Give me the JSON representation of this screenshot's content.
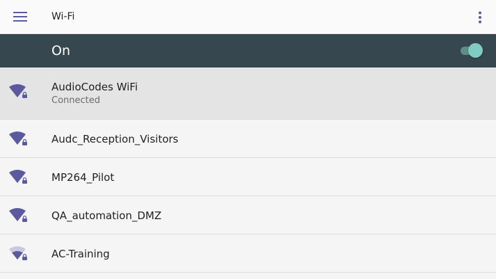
{
  "header": {
    "title": "Wi-Fi",
    "menu_icon": "hamburger-menu-icon",
    "overflow_icon": "more-vert-icon"
  },
  "switch_bar": {
    "label": "On",
    "enabled": true
  },
  "networks": [
    {
      "name": "AudioCodes WiFi",
      "status": "Connected",
      "secured": true,
      "signal": "full"
    },
    {
      "name": "Audc_Reception_Visitors",
      "secured": true,
      "signal": "full"
    },
    {
      "name": "MP264_Pilot",
      "secured": true,
      "signal": "full"
    },
    {
      "name": "QA_automation_DMZ",
      "secured": true,
      "signal": "full"
    },
    {
      "name": "AC-Training",
      "secured": true,
      "signal": "medium"
    }
  ],
  "colors": {
    "accent": "#5c5a9e",
    "header_bar": "#37474f",
    "toggle_thumb": "#80cbc4"
  }
}
